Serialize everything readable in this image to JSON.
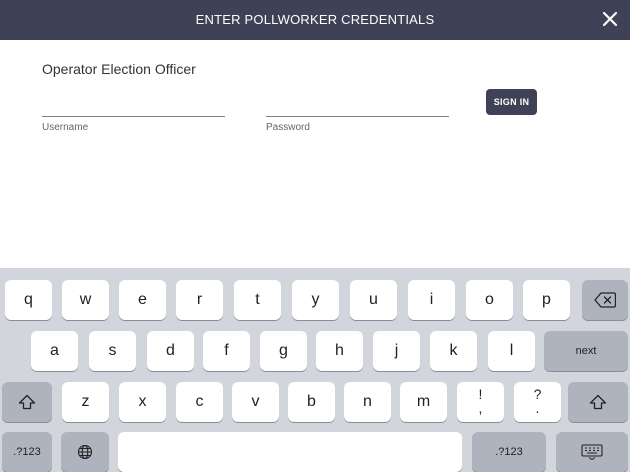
{
  "dialog": {
    "title": "ENTER POLLWORKER CREDENTIALS",
    "role_label": "Operator Election Officer",
    "username": {
      "label": "Username",
      "value": ""
    },
    "password": {
      "label": "Password",
      "value": ""
    },
    "signin_label": "SIGN IN"
  },
  "keyboard": {
    "row1": [
      "q",
      "w",
      "e",
      "r",
      "t",
      "y",
      "u",
      "i",
      "o",
      "p"
    ],
    "row2": [
      "a",
      "s",
      "d",
      "f",
      "g",
      "h",
      "j",
      "k",
      "l"
    ],
    "row3": [
      "z",
      "x",
      "c",
      "v",
      "b",
      "n",
      "m"
    ],
    "punct1": {
      "top": "!",
      "bottom": ","
    },
    "punct2": {
      "top": "?",
      "bottom": "."
    },
    "next_label": "next",
    "numbers_left_label": ".?123",
    "numbers_right_label": ".?123",
    "icons": {
      "backspace": "backspace-icon",
      "shift": "shift-icon",
      "globe": "globe-icon",
      "hide_keyboard": "keyboard-hide-icon",
      "close": "close-icon"
    }
  },
  "colors": {
    "header_bg": "#3f4257",
    "button_bg": "#3f4257",
    "keyboard_bg": "#d2d5db",
    "key_bg": "#ffffff",
    "key_dark_bg": "#aeb3bd"
  }
}
